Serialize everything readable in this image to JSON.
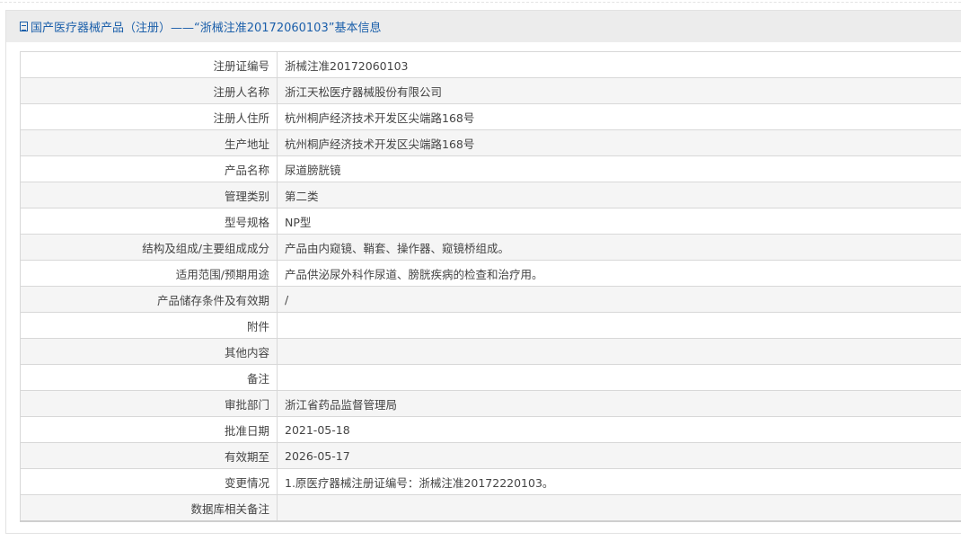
{
  "header": {
    "icon": "document-icon",
    "title": "国产医疗器械产品（注册）——“浙械注准20172060103”基本信息"
  },
  "rows": [
    {
      "label": "注册证编号",
      "value": "浙械注准20172060103"
    },
    {
      "label": "注册人名称",
      "value": "浙江天松医疗器械股份有限公司"
    },
    {
      "label": "注册人住所",
      "value": "杭州桐庐经济技术开发区尖端路168号"
    },
    {
      "label": "生产地址",
      "value": "杭州桐庐经济技术开发区尖端路168号"
    },
    {
      "label": "产品名称",
      "value": "尿道膀胱镜"
    },
    {
      "label": "管理类别",
      "value": "第二类"
    },
    {
      "label": "型号规格",
      "value": "NP型"
    },
    {
      "label": "结构及组成/主要组成成分",
      "value": "产品由内窥镜、鞘套、操作器、窥镜桥组成。"
    },
    {
      "label": "适用范围/预期用途",
      "value": "产品供泌尿外科作尿道、膀胱疾病的检查和治疗用。"
    },
    {
      "label": "产品储存条件及有效期",
      "value": "/"
    },
    {
      "label": "附件",
      "value": ""
    },
    {
      "label": "其他内容",
      "value": ""
    },
    {
      "label": "备注",
      "value": ""
    },
    {
      "label": "审批部门",
      "value": "浙江省药品监督管理局"
    },
    {
      "label": "批准日期",
      "value": "2021-05-18"
    },
    {
      "label": "有效期至",
      "value": "2026-05-17"
    },
    {
      "label": "变更情况",
      "value": "1.原医疗器械注册证编号：浙械注准20172220103。"
    },
    {
      "label": "数据库相关备注",
      "value": ""
    }
  ]
}
